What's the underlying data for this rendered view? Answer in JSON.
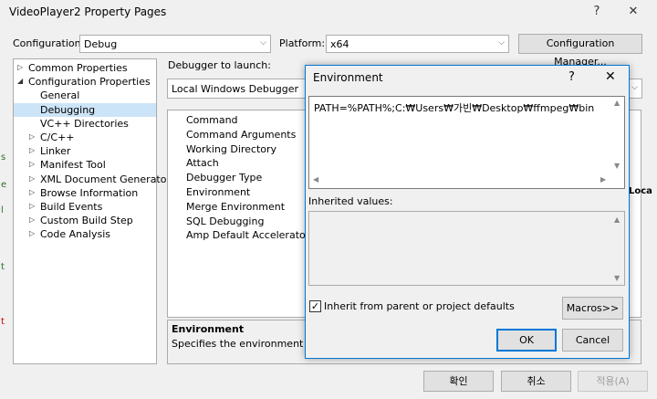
{
  "main_window": {
    "title": "VideoPlayer2 Property Pages",
    "help_glyph": "?",
    "close_glyph": "✕",
    "configuration_label": "Configuration:",
    "configuration_value": "Debug",
    "platform_label": "Platform:",
    "platform_value": "x64",
    "config_manager_label": "Configuration Manager...",
    "debugger_to_launch_label": "Debugger to launch:",
    "debugger_value": "Local Windows Debugger",
    "tree": [
      {
        "label": "Common Properties",
        "expander": "▷"
      },
      {
        "label": "Configuration Properties",
        "expander": "◢"
      },
      {
        "label": "General",
        "expander": ""
      },
      {
        "label": "Debugging",
        "expander": ""
      },
      {
        "label": "VC++ Directories",
        "expander": ""
      },
      {
        "label": "C/C++",
        "expander": "▷"
      },
      {
        "label": "Linker",
        "expander": "▷"
      },
      {
        "label": "Manifest Tool",
        "expander": "▷"
      },
      {
        "label": "XML Document Generator",
        "expander": "▷"
      },
      {
        "label": "Browse Information",
        "expander": "▷"
      },
      {
        "label": "Build Events",
        "expander": "▷"
      },
      {
        "label": "Custom Build Step",
        "expander": "▷"
      },
      {
        "label": "Code Analysis",
        "expander": "▷"
      }
    ],
    "properties": [
      "Command",
      "Command Arguments",
      "Working Directory",
      "Attach",
      "Debugger Type",
      "Environment",
      "Merge Environment",
      "SQL Debugging",
      "Amp Default Accelerator"
    ],
    "truncated_value": "Loca",
    "description_title": "Environment",
    "description_text": "Specifies the environment for th",
    "ok_label": "확인",
    "cancel_label": "취소",
    "apply_label": "적용(A)"
  },
  "env_dialog": {
    "title": "Environment",
    "help_glyph": "?",
    "close_glyph": "✕",
    "value": "PATH=%PATH%;C:₩Users₩가빈₩Desktop₩ffmpeg₩bin",
    "inherited_label": "Inherited values:",
    "inherit_checkbox_label": "Inherit from parent or project defaults",
    "inherit_checked": true,
    "check_glyph": "✓",
    "macros_label": "Macros>>",
    "ok_label": "OK",
    "cancel_label": "Cancel"
  },
  "stray_glyphs": [
    "s",
    "e",
    "l",
    "t",
    "t"
  ]
}
